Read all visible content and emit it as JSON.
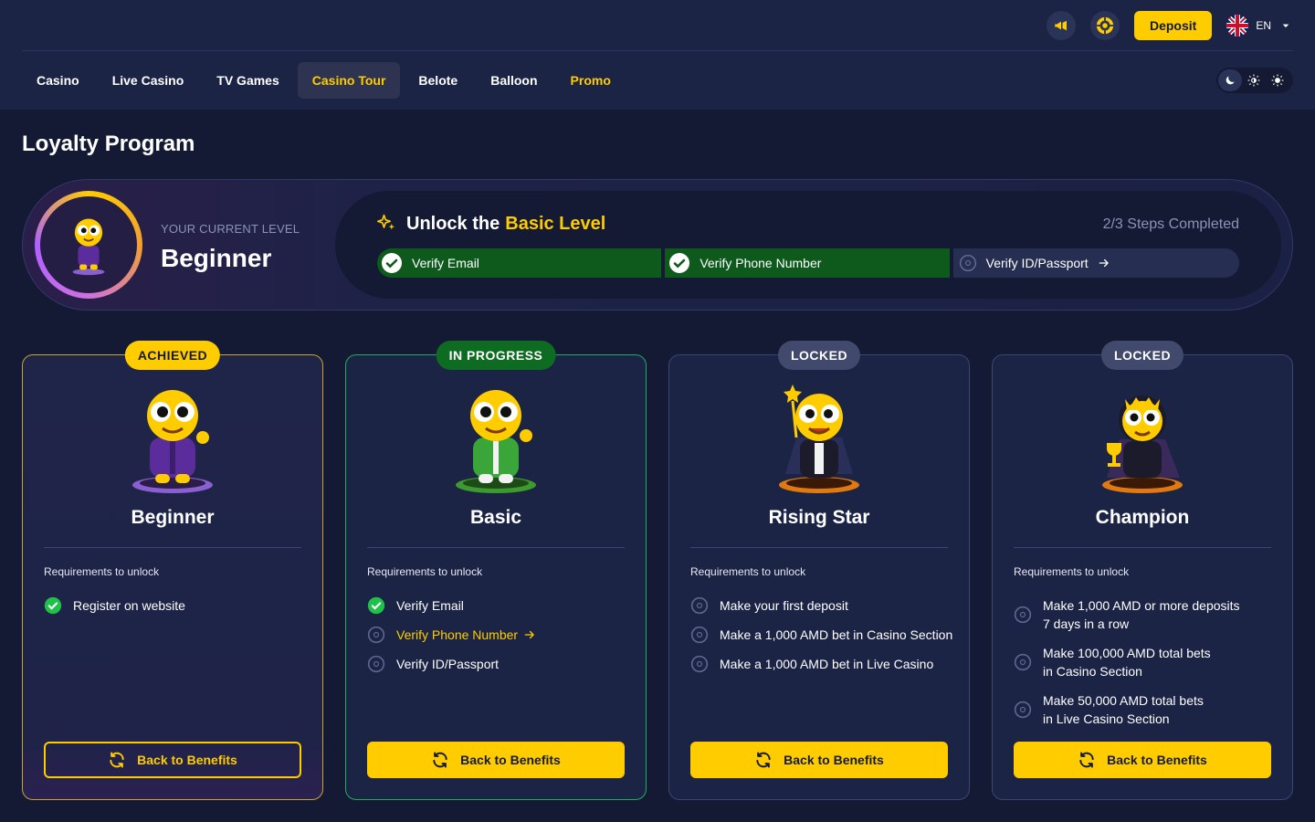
{
  "header": {
    "deposit_label": "Deposit",
    "language": "EN",
    "icons": [
      "megaphone-icon",
      "chip-icon",
      "uk-flag-icon",
      "caret-down-icon"
    ]
  },
  "nav": {
    "items": [
      {
        "label": "Casino"
      },
      {
        "label": "Live Casino"
      },
      {
        "label": "TV Games"
      },
      {
        "label": "Casino Tour",
        "active": true
      },
      {
        "label": "Belote"
      },
      {
        "label": "Balloon"
      },
      {
        "label": "Promo"
      }
    ],
    "theme_options": [
      "moon-icon",
      "auto-theme-icon",
      "sun-icon"
    ]
  },
  "page": {
    "title": "Loyalty Program"
  },
  "current_level": {
    "label": "YOUR CURRENT LEVEL",
    "name": "Beginner"
  },
  "unlock": {
    "title_prefix": "Unlock the",
    "title_highlight": "Basic Level",
    "steps_completed": "2/3 Steps Completed",
    "steps": [
      {
        "label": "Verify Email",
        "done": true
      },
      {
        "label": "Verify Phone Number",
        "done": true
      },
      {
        "label": "Verify ID/Passport",
        "done": false
      }
    ]
  },
  "requirements_label": "Requirements to unlock",
  "back_label": "Back to Benefits",
  "cards": [
    {
      "badge": "ACHIEVED",
      "name": "Beginner",
      "requirements": [
        {
          "text": "Register on website",
          "state": "done"
        }
      ]
    },
    {
      "badge": "IN PROGRESS",
      "name": "Basic",
      "requirements": [
        {
          "text": "Verify Email",
          "state": "done"
        },
        {
          "text": "Verify Phone Number",
          "state": "link"
        },
        {
          "text": "Verify ID/Passport",
          "state": "pending"
        }
      ]
    },
    {
      "badge": "LOCKED",
      "name": "Rising Star",
      "requirements": [
        {
          "text": "Make your first deposit",
          "state": "pending"
        },
        {
          "text": "Make a 1,000 AMD bet in Casino Section",
          "state": "pending"
        },
        {
          "text": "Make a 1,000 AMD bet in Live Casino",
          "state": "pending"
        }
      ]
    },
    {
      "badge": "LOCKED",
      "name": "Champion",
      "requirements": [
        {
          "text": "Make 1,000 AMD or more deposits\n7 days in a row",
          "state": "pending"
        },
        {
          "text": "Make 100,000 AMD total bets\nin Casino Section",
          "state": "pending"
        },
        {
          "text": "Make 50,000 AMD total bets\nin Live Casino Section",
          "state": "pending"
        }
      ]
    }
  ],
  "colors": {
    "accent": "#ffcc00",
    "success": "#0e5a1c",
    "background": "#141a33",
    "surface": "#1c2445"
  }
}
